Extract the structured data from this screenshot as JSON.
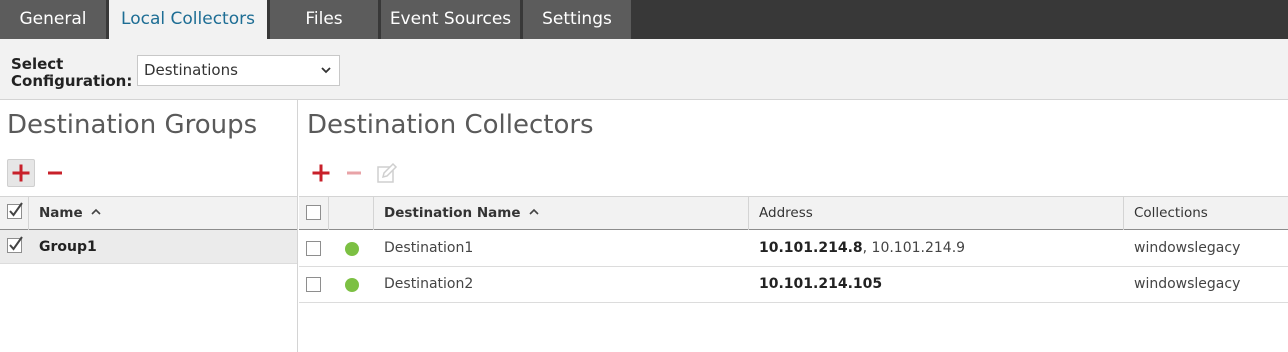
{
  "tabs": [
    {
      "label": "General"
    },
    {
      "label": "Local Collectors"
    },
    {
      "label": "Files"
    },
    {
      "label": "Event Sources"
    },
    {
      "label": "Settings"
    }
  ],
  "config": {
    "label": "Select\nConfiguration:",
    "selected": "Destinations"
  },
  "left": {
    "title": "Destination Groups",
    "header": {
      "name": "Name"
    },
    "rows": [
      {
        "name": "Group1",
        "checked": true
      }
    ]
  },
  "right": {
    "title": "Destination Collectors",
    "header": {
      "name": "Destination Name",
      "address": "Address",
      "collections": "Collections"
    },
    "rows": [
      {
        "name": "Destination1",
        "address_primary": "10.101.214.8",
        "address_secondary": ", 10.101.214.9",
        "collections": "windowslegacy",
        "status": "online"
      },
      {
        "name": "Destination2",
        "address_primary": "10.101.214.105",
        "address_secondary": "",
        "collections": "windowslegacy",
        "status": "online"
      }
    ]
  },
  "colors": {
    "accent": "#1d6d94",
    "add_red": "#c8202a",
    "status_green": "#7cc043",
    "tabbar": "#383838"
  }
}
